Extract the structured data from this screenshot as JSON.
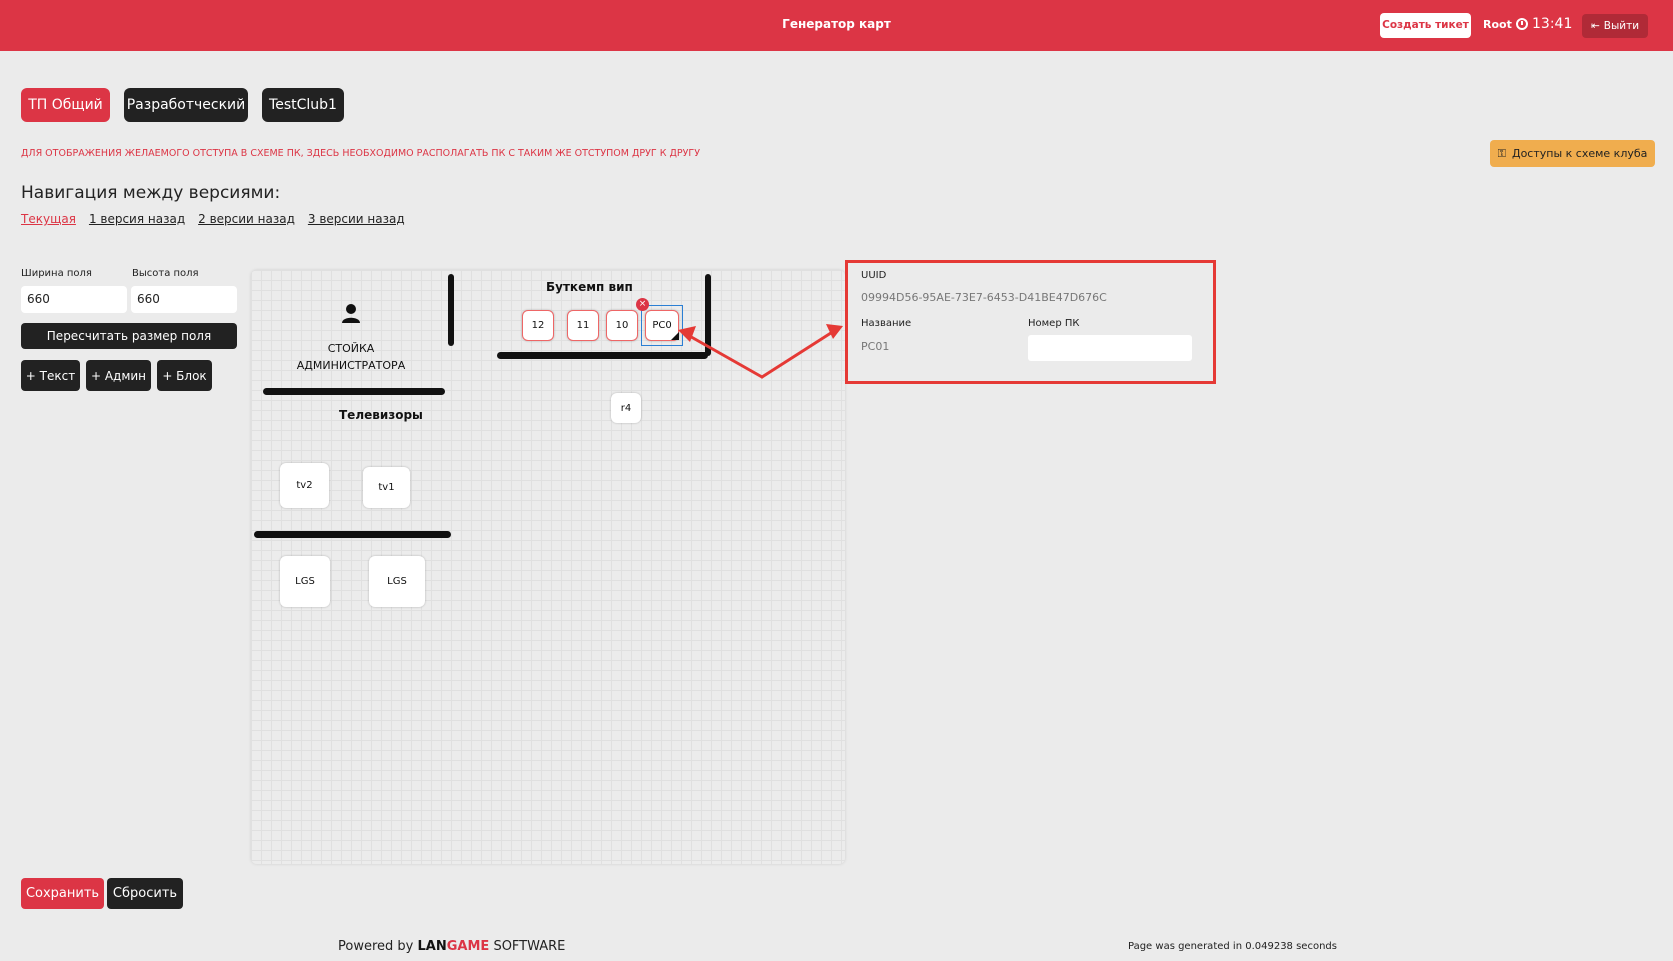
{
  "header": {
    "title": "Генератор карт",
    "create_ticket": "Создать тикет",
    "user": "Root",
    "time": "13:41",
    "logout": "Выйти"
  },
  "clubs": [
    "ТП Общий",
    "Разработческий",
    "TestClub1"
  ],
  "notice": "ДЛЯ ОТОБРАЖЕНИЯ ЖЕЛАЕМОГО ОТСТУПА В СХЕМЕ ПК, ЗДЕСЬ НЕОБХОДИМО РАСПОЛАГАТЬ ПК С ТАКИМ ЖЕ ОТСТУПОМ ДРУГ К ДРУГУ",
  "access_button": "Доступы к схеме клуба",
  "navigation": {
    "title": "Навигация между версиями:",
    "links": [
      "Текущая",
      "1 версия назад",
      "2 версии назад",
      "3 версии назад"
    ]
  },
  "field": {
    "width_label": "Ширина поля",
    "width_value": "660",
    "height_label": "Высота поля",
    "height_value": "660",
    "recalc": "Пересчитать размер поля",
    "add_text": "+ Текст",
    "add_admin": "+ Админ",
    "add_block": "+ Блок"
  },
  "canvas": {
    "admin_label_1": "СТОЙКА",
    "admin_label_2": "АДМИНИСТРАТОРА",
    "tv_title": "Телевизоры",
    "bootcamp_title": "Буткемп вип",
    "pcs": [
      "12",
      "11",
      "10",
      "PC0"
    ],
    "r4": "r4",
    "tv2": "tv2",
    "tv1": "tv1",
    "lgs1": "LGS",
    "lgs2": "LGS",
    "delete_badge": "×"
  },
  "properties": {
    "uuid_label": "UUID",
    "uuid_value": "09994D56-95AE-73E7-6453-D41BE47D676C",
    "name_label": "Название",
    "name_value": "PC01",
    "pc_number_label": "Номер ПК",
    "pc_number_value": ""
  },
  "footer": {
    "save": "Сохранить",
    "reset": "Сбросить",
    "powered_by": "Powered by",
    "brand_a": "LAN",
    "brand_b": "GAME",
    "brand_c": "SOFTWARE",
    "generated": "Page was generated in 0.049238 seconds"
  },
  "colors": {
    "accent": "#dc3545",
    "dark": "#222222",
    "warning": "#f0ad4e",
    "highlight": "#e53935"
  }
}
